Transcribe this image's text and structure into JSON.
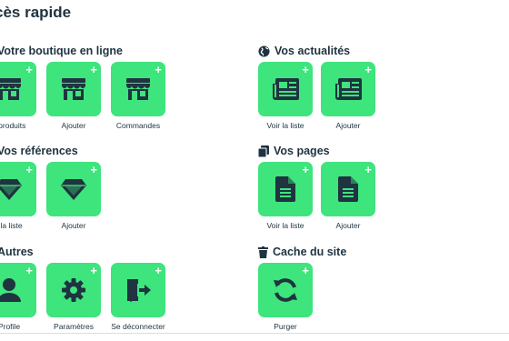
{
  "page_title": "cès rapide",
  "colors": {
    "tile": "#3ee47c",
    "icon_dark": "#1f3340",
    "text": "#1f3340"
  },
  "sections": {
    "shop": {
      "title": "Votre boutique en ligne",
      "tiles": [
        {
          "label": "s produits",
          "icon": "store-icon"
        },
        {
          "label": "Ajouter",
          "icon": "store-icon"
        },
        {
          "label": "Commandes",
          "icon": "store-icon"
        }
      ]
    },
    "references": {
      "title": "Vos références",
      "tiles": [
        {
          "label": "r la liste",
          "icon": "gem-icon"
        },
        {
          "label": "Ajouter",
          "icon": "gem-icon"
        }
      ]
    },
    "others": {
      "title": "Autres",
      "tiles": [
        {
          "label": "Profile",
          "icon": "user-icon"
        },
        {
          "label": "Paramètres",
          "icon": "cog-icon"
        },
        {
          "label": "Se déconnecter",
          "icon": "logout-icon"
        }
      ]
    },
    "news": {
      "title": "Vos actualités",
      "icon": "globe-icon",
      "tiles": [
        {
          "label": "Voir la liste",
          "icon": "newspaper-icon"
        },
        {
          "label": "Ajouter",
          "icon": "newspaper-icon"
        }
      ]
    },
    "pages": {
      "title": "Vos pages",
      "icon": "copy-icon",
      "tiles": [
        {
          "label": "Voir la liste",
          "icon": "file-icon"
        },
        {
          "label": "Ajouter",
          "icon": "file-icon"
        }
      ]
    },
    "cache": {
      "title": "Cache du site",
      "icon": "trash-icon",
      "tiles": [
        {
          "label": "Purger",
          "icon": "sync-icon"
        }
      ]
    }
  }
}
